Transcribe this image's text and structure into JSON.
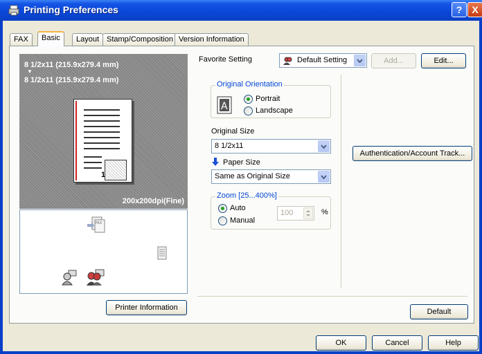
{
  "window": {
    "title": "Printing Preferences",
    "help_label": "?",
    "close_label": "X"
  },
  "tabs": [
    {
      "label": "FAX"
    },
    {
      "label": "Basic"
    },
    {
      "label": "Layout"
    },
    {
      "label": "Stamp/Composition"
    },
    {
      "label": "Version Information"
    }
  ],
  "active_tab": "Basic",
  "preview": {
    "paper_label_1": "8 1/2x11 (215.9x279.4 mm)",
    "arrow": "▼",
    "paper_label_2": "8 1/2x11 (215.9x279.4 mm)",
    "page_number": "1",
    "resolution": "200x200dpi(Fine)"
  },
  "favorite": {
    "label": "Favorite Setting",
    "value": "Default Setting",
    "add_label": "Add...",
    "edit_label": "Edit..."
  },
  "orientation": {
    "title": "Original Orientation",
    "icon_letter": "A",
    "portrait": "Portrait",
    "landscape": "Landscape",
    "selected": "Portrait"
  },
  "original_size": {
    "label": "Original Size",
    "value": "8 1/2x11"
  },
  "paper_size": {
    "label": "Paper Size",
    "value": "Same as Original Size"
  },
  "zoom": {
    "title": "Zoom [25...400%]",
    "auto": "Auto",
    "manual": "Manual",
    "selected": "Auto",
    "value": "100",
    "unit": "%"
  },
  "buttons": {
    "auth": "Authentication/Account Track...",
    "printer_info": "Printer Information",
    "default": "Default",
    "ok": "OK",
    "cancel": "Cancel",
    "help": "Help"
  },
  "colors": {
    "titlebar": "#0a46d8",
    "dialog_bg": "#ece9d8",
    "group_title": "#0046d5"
  }
}
